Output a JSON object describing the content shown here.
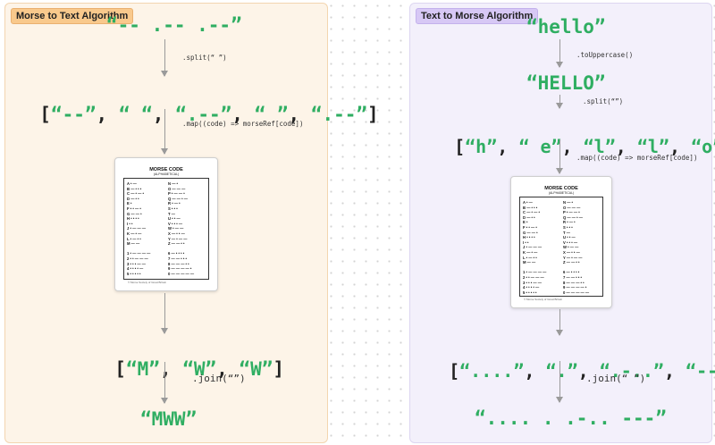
{
  "left": {
    "title": "Morse to Text Algorithm",
    "input": "“-- .-- .--”",
    "split": ".split(“ ”)",
    "array1": "[“--”, “ “, “.--”, “ ”, “.--”]",
    "map": ".map((code) => morseRef[code])",
    "array2": "[“M”, “W”, “W”]",
    "join": ".join(“”)",
    "output": "“MWW”"
  },
  "right": {
    "title": "Text to Morse Algorithm",
    "input": "“hello”",
    "upper": ".toUppercase()",
    "upper_result": "“HELLO”",
    "split": ".split(“”)",
    "array1": "[“h”, “ e”, “l”, “l”, “o”]",
    "map": ".map((code) => morseRef[code])",
    "array2": "[“....”, “.”, “.-..”, “---”]",
    "join": ".join(“ ”)",
    "output": "“.... . .-.. ---”"
  },
  "morse_card": {
    "title": "MORSE CODE",
    "subtitle": "(ALPHABETICAL)",
    "footer": "© Morse Society of Great Britain",
    "left_col": [
      "A • —",
      "B — • • •",
      "C — • — •",
      "D — • •",
      "E •",
      "F • • — •",
      "G — — •",
      "H • • • •",
      "I • •",
      "J • — — —",
      "K — • —",
      "L • — • •",
      "M — —",
      "",
      "1 • — — — —",
      "2 • • — — —",
      "3 • • • — —",
      "4 • • • • —",
      "5 • • • • •"
    ],
    "right_col": [
      "N — •",
      "O — — —",
      "P • — — •",
      "Q — — • —",
      "R • — •",
      "S • • •",
      "T —",
      "U • • —",
      "V • • • —",
      "W • — —",
      "X — • • —",
      "Y — • — —",
      "Z — — • •",
      "",
      "6 — • • • •",
      "7 — — • • •",
      "8 — — — • •",
      "9 — — — — •",
      "0 — — — — —"
    ]
  }
}
